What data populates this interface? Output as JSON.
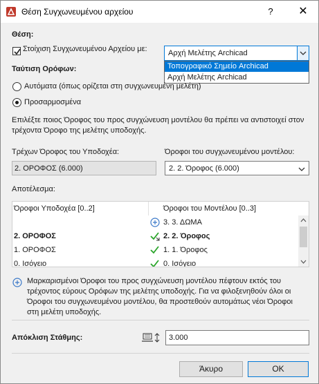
{
  "window": {
    "title": "Θέση Συγχωνευμένου αρχείου",
    "help_label": "?",
    "close_label": "✕"
  },
  "placement": {
    "heading": "Θέση:",
    "align_label": "Στοίχιση Συγχωνευμένου Αρχείου με:",
    "align_checked": true,
    "align_value": "Αρχή Μελέτης Archicad",
    "options": [
      "Τοπογραφικό Σημείο Archicad",
      "Αρχή Μελέτης Archicad"
    ],
    "highlighted_option": "Τοπογραφικό Σημείο Archicad"
  },
  "story_matching": {
    "heading": "Ταύτιση Ορόφων:",
    "auto_label": "Αυτόματα (όπως ορίζεται στη συγχωνευμένη μελέτη)",
    "custom_label": "Προσαρμοσμένα",
    "selected": "custom",
    "description": "Επιλέξτε ποιος Όροφος του προς συγχώνευση μοντέλου θα πρέπει να αντιστοιχεί στον τρέχοντα Όροφο της μελέτης υποδοχής.",
    "host_story_label": "Τρέχων Όροφος του Υποδοχέα:",
    "host_story_value": "2. ΟΡΟΦΟΣ (6.000)",
    "merged_story_label": "Όροφοι του συγχωνευμένου μοντέλου:",
    "merged_story_value": "2. 2. Όροφος (6.000)"
  },
  "result": {
    "heading": "Αποτέλεσμα:",
    "col_host": "Όροφοι Υποδοχέα [0..2]",
    "col_model": "Όροφοι του Μοντέλου [0..3]",
    "rows": [
      {
        "host": "",
        "icon": "plus-circle-icon",
        "model": "3. 3. ΔΩΜΑ",
        "bold": false
      },
      {
        "host": "2. ΟΡΟΦΟΣ",
        "icon": "check-link-icon",
        "model": "2. 2. Όροφος",
        "bold": true
      },
      {
        "host": "1. ΟΡΟΦΟΣ",
        "icon": "check-icon",
        "model": "1. 1. Όροφος",
        "bold": false
      },
      {
        "host": "0. Ισόγειο",
        "icon": "check-icon",
        "model": "0. Ισόγειο",
        "bold": false
      }
    ],
    "info_text": "Μαρκαρισμένοι Όροφοι του προς συγχώνευση μοντέλου πέφτουν εκτός του τρέχοντος εύρους Ορόφων της μελέτης υποδοχής. Για να φιλοξενηθούν όλοι οι Όροφοι του συγχωνευμένου μοντέλου, θα προστεθούν αυτομάτως νέοι Όροφοι στη μελέτη υποδοχής."
  },
  "elevation": {
    "label": "Απόκλιση Στάθμης:",
    "value": "3.000"
  },
  "buttons": {
    "cancel": "Άκυρο",
    "ok": "OK"
  },
  "colors": {
    "accent": "#0078d7",
    "check_green": "#2aa52a",
    "plus_blue": "#3a78c8"
  }
}
